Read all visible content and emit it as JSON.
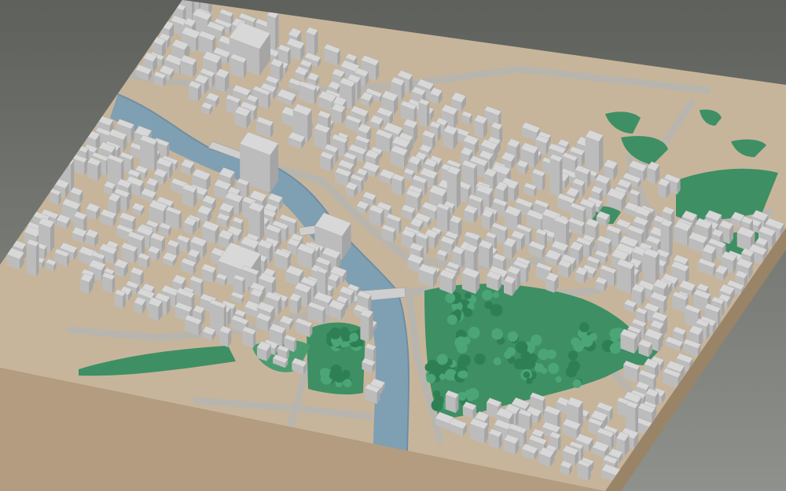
{
  "scene": {
    "kind": "3d-city-model",
    "colors": {
      "background_top": "#5e605c",
      "background_bottom": "#8f918c",
      "plinth_side": "#b39c7f",
      "plinth_side_dark": "#9a8468",
      "ground": "#c7b59b",
      "road": "#b7b5ae",
      "river": "#7f9fb3",
      "river_edge": "#6e8ea4",
      "park": "#3e8f64",
      "park_light": "#4a9c70",
      "tree": "#2f7f55",
      "tree_light": "#4ba576",
      "building_top": "#d8d8d8",
      "building_left": "#bcbcbc",
      "building_right": "#a5a5a5",
      "bridge": "#cfcfcf"
    }
  }
}
